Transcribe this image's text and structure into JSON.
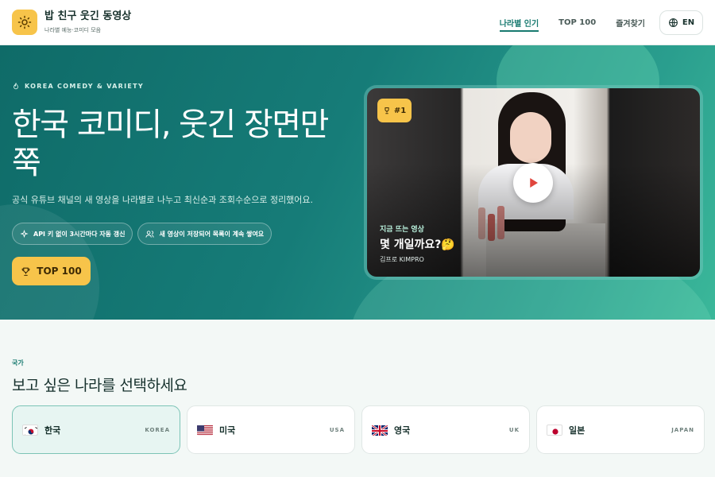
{
  "header": {
    "brand_title": "밥 친구 웃긴 동영상",
    "brand_subtitle": "나라별 예능·코미디 모음",
    "nav": [
      {
        "label": "나라별 인기",
        "active": true
      },
      {
        "label": "TOP 100",
        "active": false
      },
      {
        "label": "즐겨찾기",
        "active": false
      }
    ],
    "lang_label": "EN"
  },
  "hero": {
    "eyebrow": "KOREA COMEDY & VARIETY",
    "title": "한국 코미디, 웃긴 장면만 쭉",
    "description": "공식 유튜브 채널의 새 영상을 나라별로 나누고 최신순과 조회수순으로 정리했어요.",
    "chips": [
      {
        "icon": "sparkle-icon",
        "label": "API 키 없이 3시간마다 자동 갱신"
      },
      {
        "icon": "users-icon",
        "label": "새 영상이 저장되어 목록이 계속 쌓여요"
      }
    ],
    "cta_label": "TOP 100"
  },
  "featured": {
    "rank": "#1",
    "tag": "지금 뜨는 영상",
    "title": "몇 개일까요?🤔",
    "channel": "김프로 KIMPRO"
  },
  "countries_section": {
    "label": "국가",
    "title": "보고 싶은 나라를 선택하세요",
    "items": [
      {
        "name": "한국",
        "en": "KOREA",
        "flag": "kr-flag-icon",
        "selected": true
      },
      {
        "name": "미국",
        "en": "USA",
        "flag": "us-flag-icon",
        "selected": false
      },
      {
        "name": "영국",
        "en": "UK",
        "flag": "uk-flag-icon",
        "selected": false
      },
      {
        "name": "일본",
        "en": "JAPAN",
        "flag": "jp-flag-icon",
        "selected": false
      }
    ]
  },
  "colors": {
    "accent": "#187a70",
    "yellow": "#f7c44a",
    "hero_start": "#0f6b68",
    "hero_end": "#3bb89a"
  }
}
